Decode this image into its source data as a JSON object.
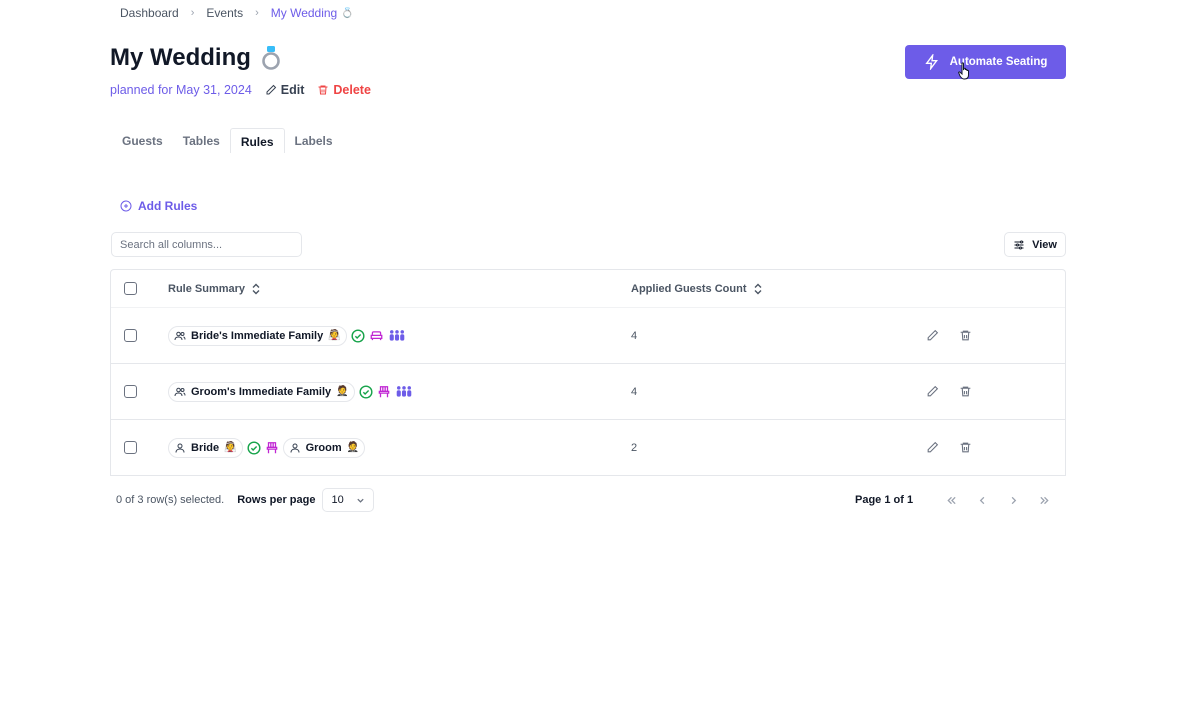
{
  "breadcrumb": {
    "items": [
      "Dashboard",
      "Events",
      "My Wedding"
    ],
    "current_emoji": "💍"
  },
  "header": {
    "title": "My Wedding",
    "title_emoji": "💍",
    "planned": "planned for May 31, 2024",
    "edit_label": "Edit",
    "delete_label": "Delete",
    "automate_label": "Automate Seating"
  },
  "tabs": [
    {
      "label": "Guests",
      "active": false
    },
    {
      "label": "Tables",
      "active": false
    },
    {
      "label": "Rules",
      "active": true
    },
    {
      "label": "Labels",
      "active": false
    }
  ],
  "add_rules_label": "Add Rules",
  "search": {
    "placeholder": "Search all columns...",
    "value": ""
  },
  "view_label": "View",
  "table": {
    "columns": [
      "Rule Summary",
      "Applied Guests Count"
    ],
    "rows": [
      {
        "chip1": "Bride's Immediate Family",
        "chip1_emoji": "👰",
        "chip2": "",
        "chip2_emoji": "",
        "count": "4"
      },
      {
        "chip1": "Groom's Immediate Family",
        "chip1_emoji": "🤵",
        "chip2": "",
        "chip2_emoji": "",
        "count": "4"
      },
      {
        "chip1": "Bride",
        "chip1_emoji": "👰",
        "chip2": "Groom",
        "chip2_emoji": "🤵",
        "count": "2"
      }
    ]
  },
  "footer": {
    "selected": "0 of 3 row(s) selected.",
    "rows_per_page_label": "Rows per page",
    "rows_per_page_value": "10",
    "page_text": "Page 1 of 1"
  },
  "colors": {
    "accent": "#6d5ce8",
    "danger": "#ef4444",
    "check_green": "#16a34a",
    "seat_magenta": "#c026d3"
  }
}
